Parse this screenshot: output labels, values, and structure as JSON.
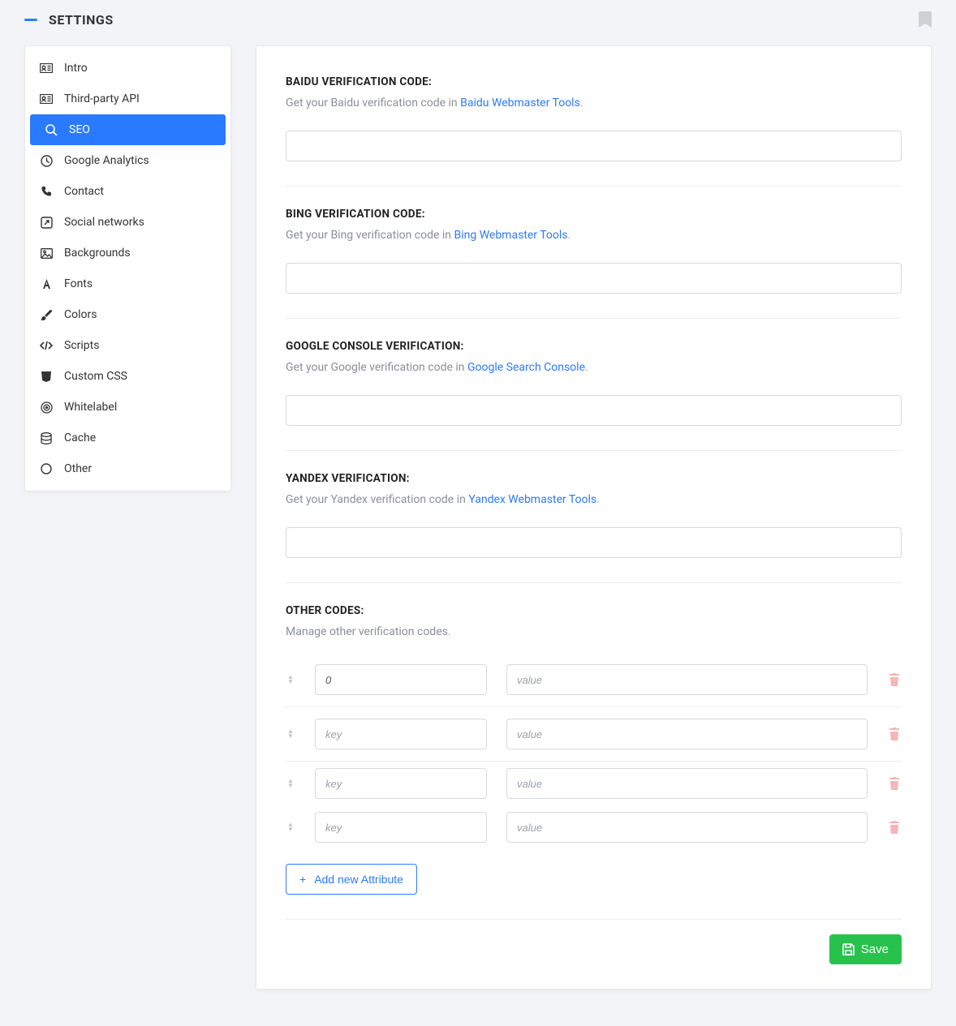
{
  "page_title": "SETTINGS",
  "sidebar": {
    "items": [
      {
        "label": "Intro",
        "icon": "id-card"
      },
      {
        "label": "Third-party API",
        "icon": "id-card"
      },
      {
        "label": "SEO",
        "icon": "search",
        "active": true
      },
      {
        "label": "Google Analytics",
        "icon": "clock"
      },
      {
        "label": "Contact",
        "icon": "phone"
      },
      {
        "label": "Social networks",
        "icon": "share"
      },
      {
        "label": "Backgrounds",
        "icon": "image"
      },
      {
        "label": "Fonts",
        "icon": "font"
      },
      {
        "label": "Colors",
        "icon": "brush"
      },
      {
        "label": "Scripts",
        "icon": "code"
      },
      {
        "label": "Custom CSS",
        "icon": "css"
      },
      {
        "label": "Whitelabel",
        "icon": "target"
      },
      {
        "label": "Cache",
        "icon": "database"
      },
      {
        "label": "Other",
        "icon": "circle"
      }
    ]
  },
  "fields": {
    "baidu": {
      "label": "BAIDU VERIFICATION CODE:",
      "desc_pre": "Get your Baidu verification code in ",
      "desc_link": "Baidu Webmaster Tools",
      "value": ""
    },
    "bing": {
      "label": "BING VERIFICATION CODE:",
      "desc_pre": "Get your Bing verification code in ",
      "desc_link": "Bing Webmaster Tools",
      "value": ""
    },
    "google": {
      "label": "GOOGLE CONSOLE VERIFICATION:",
      "desc_pre": "Get your Google verification code in ",
      "desc_link": "Google Search Console",
      "value": ""
    },
    "yandex": {
      "label": "YANDEX VERIFICATION:",
      "desc_pre": "Get your Yandex verification code in ",
      "desc_link": "Yandex Webmaster Tools",
      "value": ""
    },
    "other": {
      "label": "OTHER CODES:",
      "desc": "Manage other verification codes.",
      "key_placeholder": "key",
      "value_placeholder": "value",
      "rows": [
        {
          "key": "0",
          "value": ""
        },
        {
          "key": "",
          "value": ""
        },
        {
          "key": "",
          "value": ""
        },
        {
          "key": "",
          "value": ""
        }
      ]
    }
  },
  "buttons": {
    "add_attr": "Add new Attribute",
    "save": "Save"
  }
}
